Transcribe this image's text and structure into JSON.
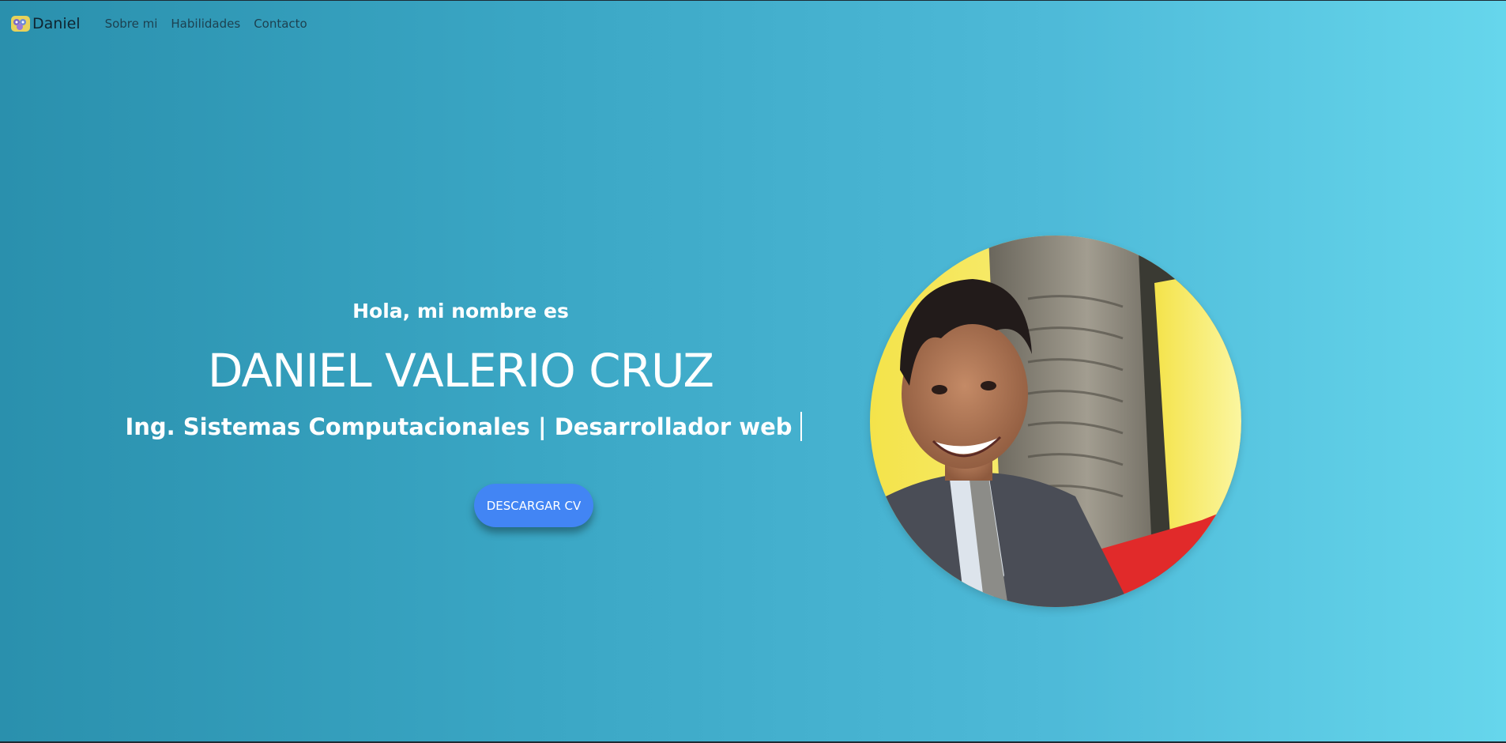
{
  "navbar": {
    "brand": "Daniel",
    "links": [
      "Sobre mi",
      "Habilidades",
      "Contacto"
    ]
  },
  "hero": {
    "greeting": "Hola, mi nombre es",
    "name": "DANIEL VALERIO CRUZ",
    "subtitle": "Ing. Sistemas Computacionales | Desarrollador web",
    "cta_label": "DESCARGAR CV"
  },
  "colors": {
    "gradient_start": "#2a90ad",
    "gradient_end": "#66d6ec",
    "button": "#4285f4"
  }
}
